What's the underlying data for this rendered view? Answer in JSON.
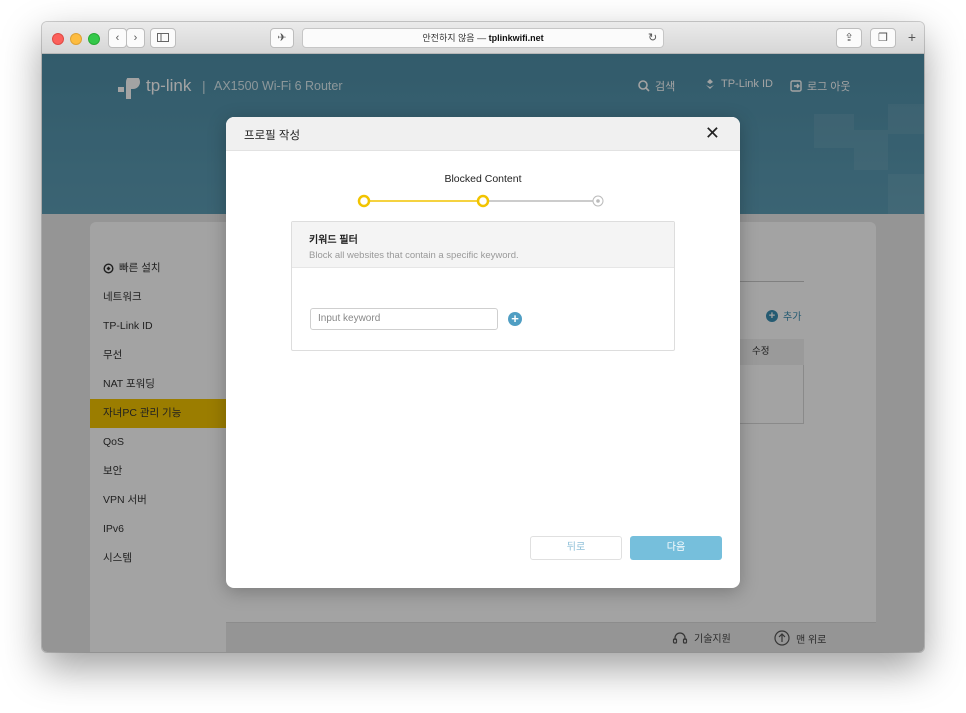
{
  "browser": {
    "url_prefix": "안전하지 않음 —",
    "url_domain": "tplinkwifi.net"
  },
  "header": {
    "brand": "tp-link",
    "separator": "|",
    "model": "AX1500 Wi-Fi 6 Router",
    "search": "검색",
    "tplink_id": "TP-Link ID",
    "logout": "로그 아웃"
  },
  "sidebar": {
    "items": [
      {
        "label": "빠른 설치"
      },
      {
        "label": "네트워크"
      },
      {
        "label": "TP-Link ID"
      },
      {
        "label": "무선"
      },
      {
        "label": "NAT 포워딩"
      },
      {
        "label": "자녀PC 관리 기능",
        "active": true
      },
      {
        "label": "QoS"
      },
      {
        "label": "보안"
      },
      {
        "label": "VPN 서버"
      },
      {
        "label": "IPv6"
      },
      {
        "label": "시스템"
      }
    ]
  },
  "background_table": {
    "add_label": "추가",
    "col_edit": "수정"
  },
  "footer": {
    "support": "기술지원",
    "top": "맨 위로"
  },
  "modal": {
    "title": "프로필 작성",
    "close": "✕",
    "step_label": "Blocked Content",
    "steps_total": 3,
    "current_step": 2,
    "card_title": "키워드 필터",
    "card_desc": "Block all websites that contain a specific keyword.",
    "input_placeholder": "Input keyword",
    "back_label": "뒤로",
    "next_label": "다음"
  },
  "colors": {
    "accent": "#f2c400",
    "hero": "#5d9db5",
    "primary_button": "#76bfdc"
  }
}
